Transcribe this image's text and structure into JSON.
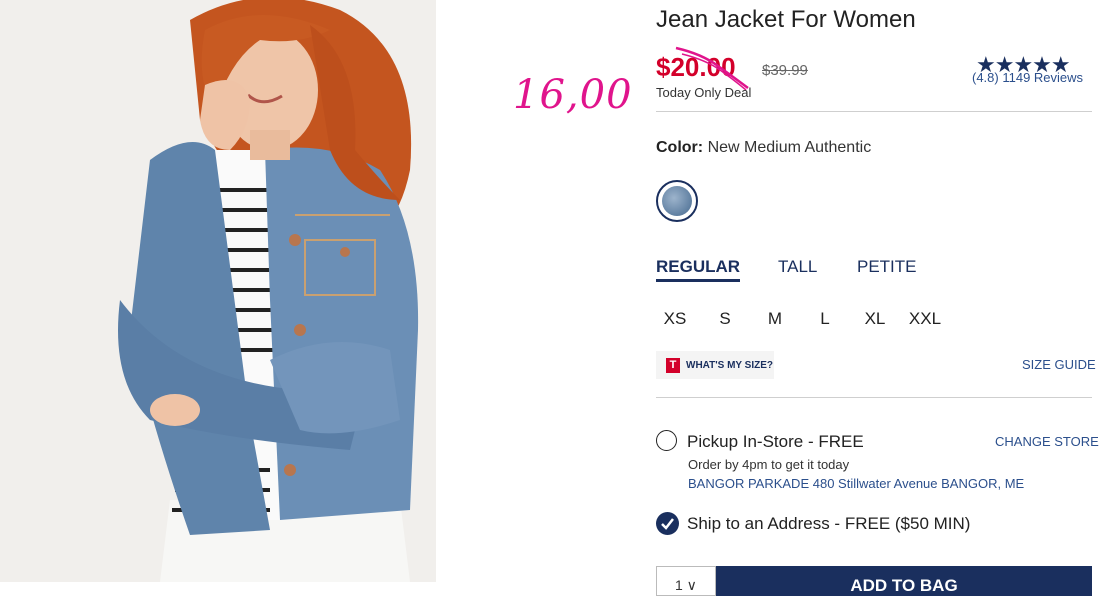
{
  "product": {
    "title": "Jean Jacket For Women",
    "sale_price": "$20.00",
    "original_price": "$39.99",
    "deal_label": "Today Only Deal",
    "rating_stars": "★★★★★",
    "reviews_text": "(4.8) 1149 Reviews"
  },
  "annotation": {
    "handwritten_price": "16,00"
  },
  "color": {
    "label": "Color:",
    "value": "New Medium Authentic"
  },
  "fit_tabs": [
    "REGULAR",
    "TALL",
    "PETITE"
  ],
  "sizes": [
    "XS",
    "S",
    "M",
    "L",
    "XL",
    "XXL"
  ],
  "size_help": {
    "logo": "T",
    "whats_my_size": "WHAT'S MY SIZE?",
    "size_guide": "SIZE GUIDE"
  },
  "pickup": {
    "label": "Pickup In-Store - FREE",
    "change_store": "CHANGE STORE",
    "order_by": "Order by 4pm to get it today",
    "store": "BANGOR PARKADE 480 Stillwater Avenue  BANGOR, ME"
  },
  "ship": {
    "label": "Ship to an Address - FREE ($50 MIN)"
  },
  "cart": {
    "qty": "1 ∨",
    "add_label": "ADD TO BAG"
  },
  "colors": {
    "brand_navy": "#1a2f5e",
    "sale_red": "#d3002a",
    "annotation_pink": "#e0148c"
  }
}
